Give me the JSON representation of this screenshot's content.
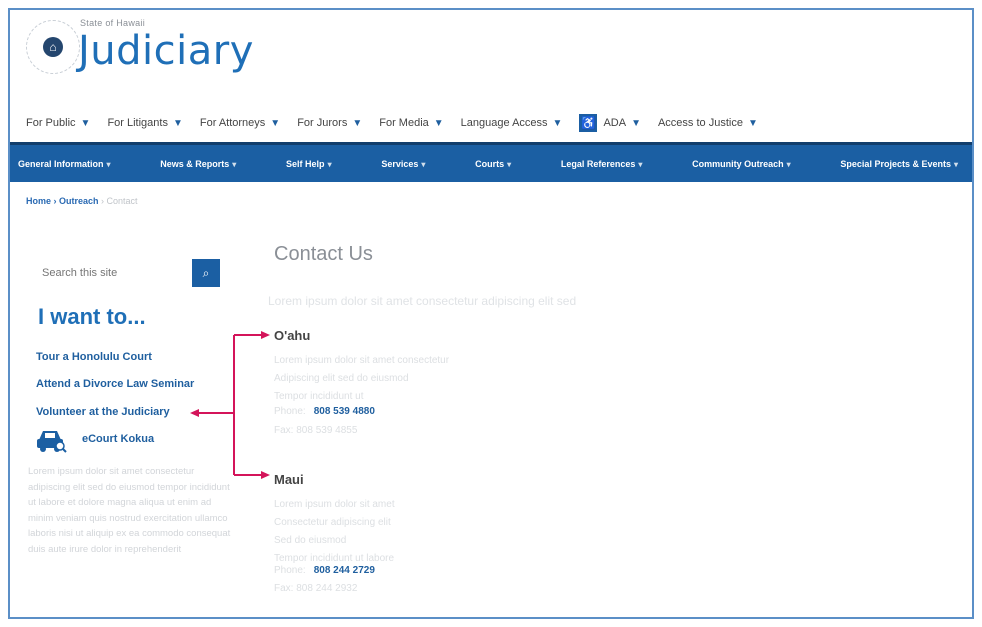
{
  "header": {
    "state_label": "State of Hawaii",
    "logo_text": "Judiciary",
    "seal_icon": "state-seal-icon"
  },
  "top_nav": [
    {
      "label": "For Public"
    },
    {
      "label": "For Litigants"
    },
    {
      "label": "For Attorneys"
    },
    {
      "label": "For Jurors"
    },
    {
      "label": "For Media"
    },
    {
      "label": "Language Access"
    },
    {
      "label": "ADA"
    },
    {
      "label": "Access to Justice"
    }
  ],
  "main_nav": [
    {
      "label": "General Information"
    },
    {
      "label": "News & Reports"
    },
    {
      "label": "Self Help"
    },
    {
      "label": "Services"
    },
    {
      "label": "Courts"
    },
    {
      "label": "Legal References"
    },
    {
      "label": "Community Outreach"
    },
    {
      "label": "Special Projects & Events"
    }
  ],
  "breadcrumb": {
    "home": "Home",
    "sep": " › ",
    "section": "Outreach",
    "current": " › Contact"
  },
  "sidebar": {
    "search_placeholder": "Search this site",
    "want_title": "I want to...",
    "links": [
      "Tour a Honolulu Court",
      "Attend a Divorce Law Seminar",
      "Volunteer at the Judiciary"
    ],
    "ecourt_label": "eCourt Kokua",
    "ecourt_text": "Lorem ipsum dolor sit amet consectetur adipiscing elit sed do eiusmod tempor incididunt ut labore et dolore magna aliqua ut enim ad minim veniam quis nostrud exercitation ullamco laboris nisi ut aliquip ex ea commodo consequat duis aute irure dolor in reprehenderit"
  },
  "main": {
    "title": "Contact Us",
    "intro": "Lorem ipsum dolor sit amet consectetur adipiscing elit sed",
    "oahu": {
      "name": "O'ahu",
      "lines": [
        "Lorem ipsum dolor sit amet consectetur",
        "Adipiscing elit sed do eiusmod",
        "Tempor incididunt ut"
      ],
      "phone_label": "Phone:",
      "phone": "808 539 4880",
      "fax_line": "Fax: 808 539 4855"
    },
    "maui": {
      "name": "Maui",
      "lines": [
        "Lorem ipsum dolor sit amet",
        "Consectetur adipiscing elit",
        "Sed do eiusmod",
        "Tempor incididunt ut labore"
      ],
      "phone_label": "Phone:",
      "phone": "808 244 2729",
      "fax_line": "Fax: 808 244 2932"
    }
  },
  "colors": {
    "brand_blue": "#1f6fb7",
    "nav_blue": "#1b5fa3",
    "arrow_red": "#d4145a"
  }
}
